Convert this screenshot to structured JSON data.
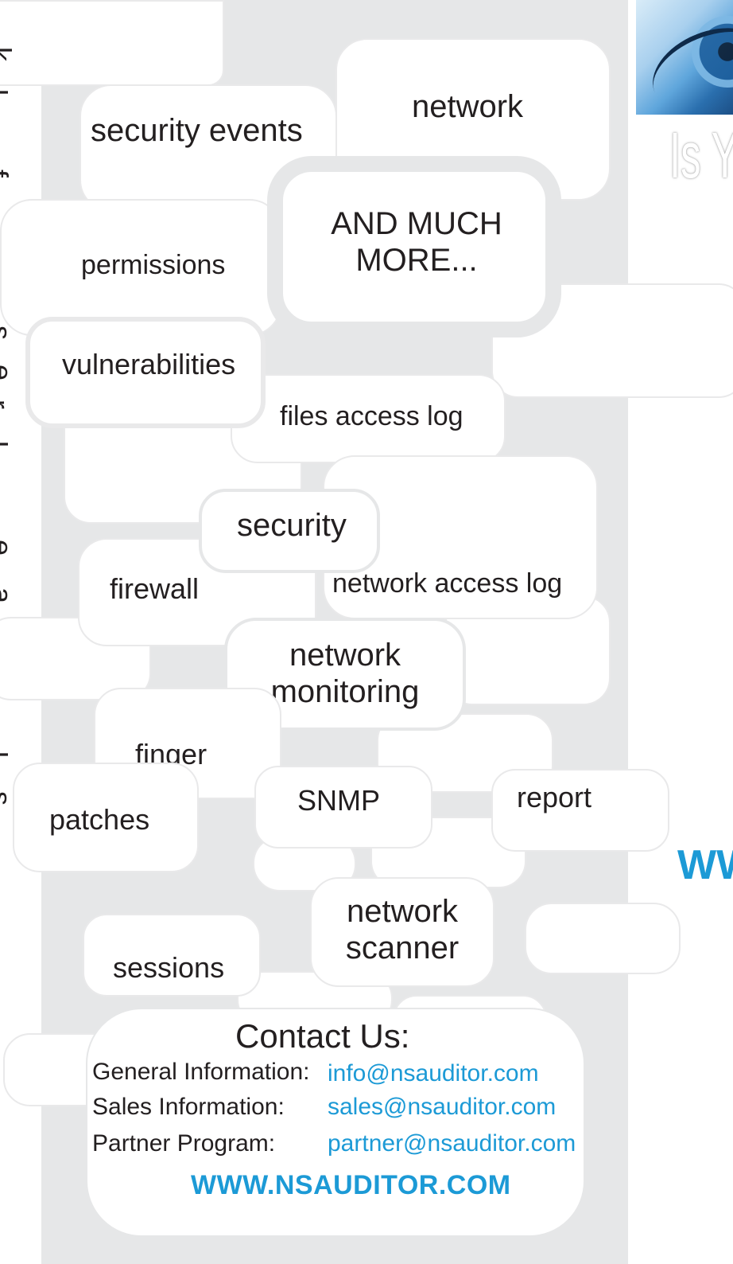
{
  "vertical_text": [
    "k",
    "I",
    "f",
    "I",
    "s",
    "e",
    "r",
    "I",
    "e",
    "a",
    "e",
    "e",
    "I",
    "s"
  ],
  "bubbles": {
    "network": "network",
    "security_events": "security events",
    "and_much_more": "AND MUCH MORE...",
    "permissions": "permissions",
    "vulnerabilities": "vulnerabilities",
    "files_access_log": "files access log",
    "security": "security",
    "firewall": "firewall",
    "network_access_log": "network access log",
    "network_monitoring": "network monitoring",
    "finger": "finger",
    "snmp": "SNMP",
    "report": "report",
    "patches": "patches",
    "network_scanner": "network scanner",
    "sessions": "sessions"
  },
  "right_panel": {
    "headline_fragment": "Is Y",
    "url_fragment": "WW"
  },
  "contact": {
    "title": "Contact Us:",
    "rows": [
      {
        "label": "General Information:",
        "email": "info@nsauditor.com"
      },
      {
        "label": "Sales Information:",
        "email": "sales@nsauditor.com"
      },
      {
        "label": "Partner Program:",
        "email": "partner@nsauditor.com"
      }
    ],
    "website": "WWW.NSAUDITOR.COM"
  },
  "colors": {
    "band_gray": "#e6e7e8",
    "accent_blue": "#1c9ad6",
    "text": "#231f20"
  }
}
